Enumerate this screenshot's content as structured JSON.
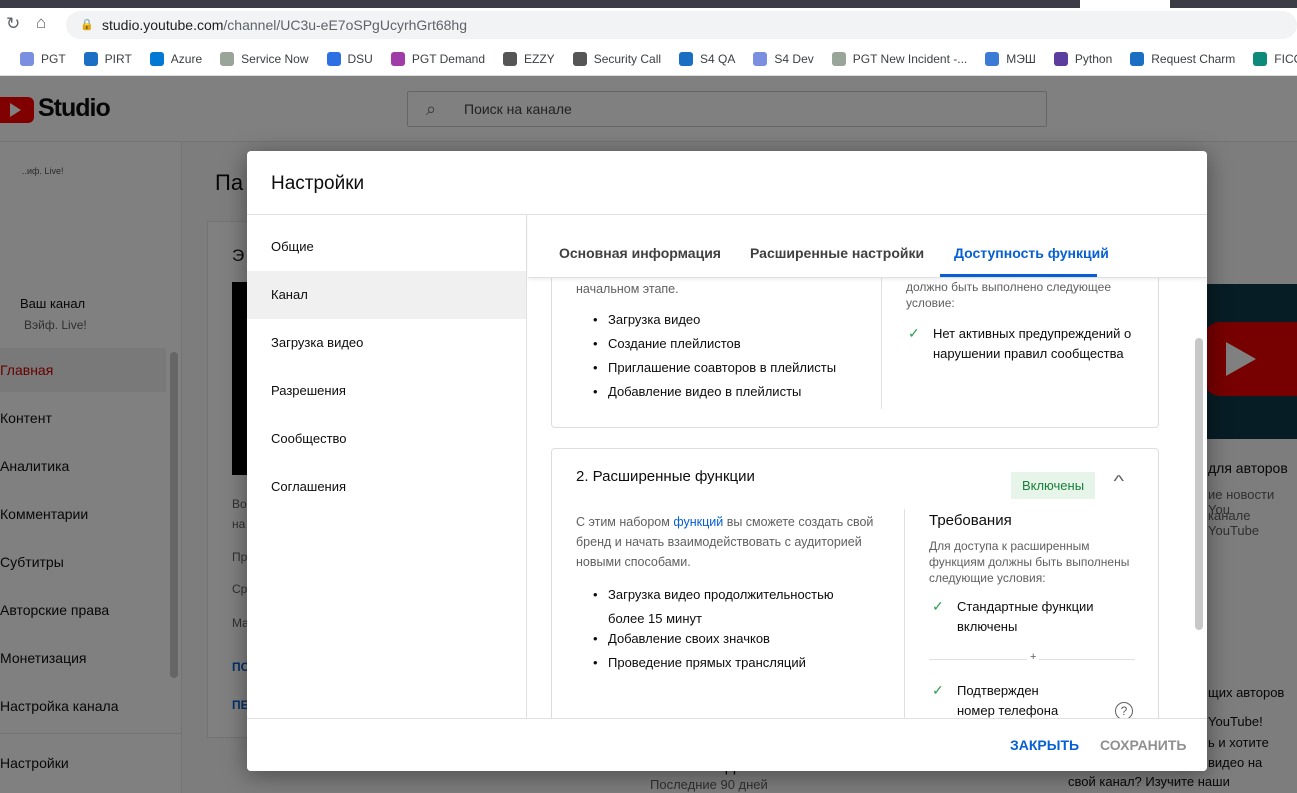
{
  "browser": {
    "url_host": "studio.youtube.com",
    "url_path": "/channel/UC3u-eE7oSPgUcyrhGrt68hg",
    "bookmarks": [
      {
        "label": "PGT",
        "color": "#7b8fe0"
      },
      {
        "label": "PIRT",
        "color": "#1a6fc2"
      },
      {
        "label": "Azure",
        "color": "#0078d4"
      },
      {
        "label": "Service Now",
        "color": "#9aa59a"
      },
      {
        "label": "DSU",
        "color": "#2f6fe4"
      },
      {
        "label": "PGT Demand",
        "color": "#a03ca8"
      },
      {
        "label": "EZZY",
        "color": "#555"
      },
      {
        "label": "Security Call",
        "color": "#555"
      },
      {
        "label": "S4 QA",
        "color": "#1a6fc2"
      },
      {
        "label": "S4 Dev",
        "color": "#7b8fe0"
      },
      {
        "label": "PGT New Incident -...",
        "color": "#9aa59a"
      },
      {
        "label": "МЭШ",
        "color": "#3b7bd6"
      },
      {
        "label": "Python",
        "color": "#5b3d9e"
      },
      {
        "label": "Request Charm",
        "color": "#1a6fc2"
      },
      {
        "label": "FICO si",
        "color": "#0d8a7a"
      }
    ]
  },
  "studio": {
    "logo": "Studio",
    "search_placeholder": "Поиск на канале",
    "channel_label": "Ваш канал",
    "channel_name": "Вэйф. Live!",
    "channel_name_top": "..иф. Live!",
    "nav": [
      {
        "label": "Главная",
        "active": true
      },
      {
        "label": "Контент"
      },
      {
        "label": "Аналитика"
      },
      {
        "label": "Комментарии"
      },
      {
        "label": "Субтитры"
      },
      {
        "label": "Авторские права"
      },
      {
        "label": "Монетизация"
      },
      {
        "label": "Настройка канала"
      }
    ],
    "settings": "Настройки",
    "page_title_partial": "Па",
    "card_title_partial": "Э",
    "bg_texts": [
      "Во",
      "на",
      "Пр",
      "Ср",
      "Ма",
      "ПО",
      "ПЕ"
    ],
    "right_heading": "для авторов",
    "right_line1": "ие новости You",
    "right_line2": "канале YouTube",
    "right2_heading": "щих авторов",
    "right2_l1": "YouTube!",
    "right2_l2": "ь и хотите",
    "right2_l3": "видео на",
    "right2_l4": "свой канал? Изучите наши",
    "bottom_title": "Новые подписчики",
    "bottom_sub": "Последние 90 дней"
  },
  "modal": {
    "title": "Настройки",
    "nav": [
      {
        "label": "Общие"
      },
      {
        "label": "Канал",
        "selected": true
      },
      {
        "label": "Загрузка видео"
      },
      {
        "label": "Разрешения"
      },
      {
        "label": "Сообщество"
      },
      {
        "label": "Соглашения"
      }
    ],
    "tabs": [
      {
        "label": "Основная информация"
      },
      {
        "label": "Расширенные настройки"
      },
      {
        "label": "Доступность функций",
        "active": true
      }
    ],
    "card1": {
      "intro_tail": "начальном этапе.",
      "items": [
        "Загрузка видео",
        "Создание плейлистов",
        "Приглашение соавторов в плейлисты",
        "Добавление видео в плейлисты"
      ],
      "req_tail": "должно быть выполнено следующее условие:",
      "req": "Нет активных предупреждений о нарушении правил сообщества"
    },
    "card2": {
      "title": "2. Расширенные функции",
      "status": "Включены",
      "desc_pre": "С этим набором ",
      "desc_link": "функций",
      "desc_post": " вы сможете создать свой бренд и начать взаимодействовать с аудиторией новыми способами.",
      "items": [
        "Загрузка видео продолжительностью более 15 минут",
        "Добавление своих значков",
        "Проведение прямых трансляций"
      ],
      "req_title": "Требования",
      "req_desc": "Для доступа к расширенным функциям должны быть выполнены следующие условия:",
      "req1": "Стандартные функции включены",
      "plus": "+",
      "req2": "Подтвержден номер телефона",
      "help": "?"
    },
    "close": "ЗАКРЫТЬ",
    "save": "СОХРАНИТЬ"
  },
  "colors": {
    "accent": "#065fd4",
    "status_bg": "#e6f4ea",
    "status_fg": "#188038",
    "check": "#2e9e4f"
  }
}
